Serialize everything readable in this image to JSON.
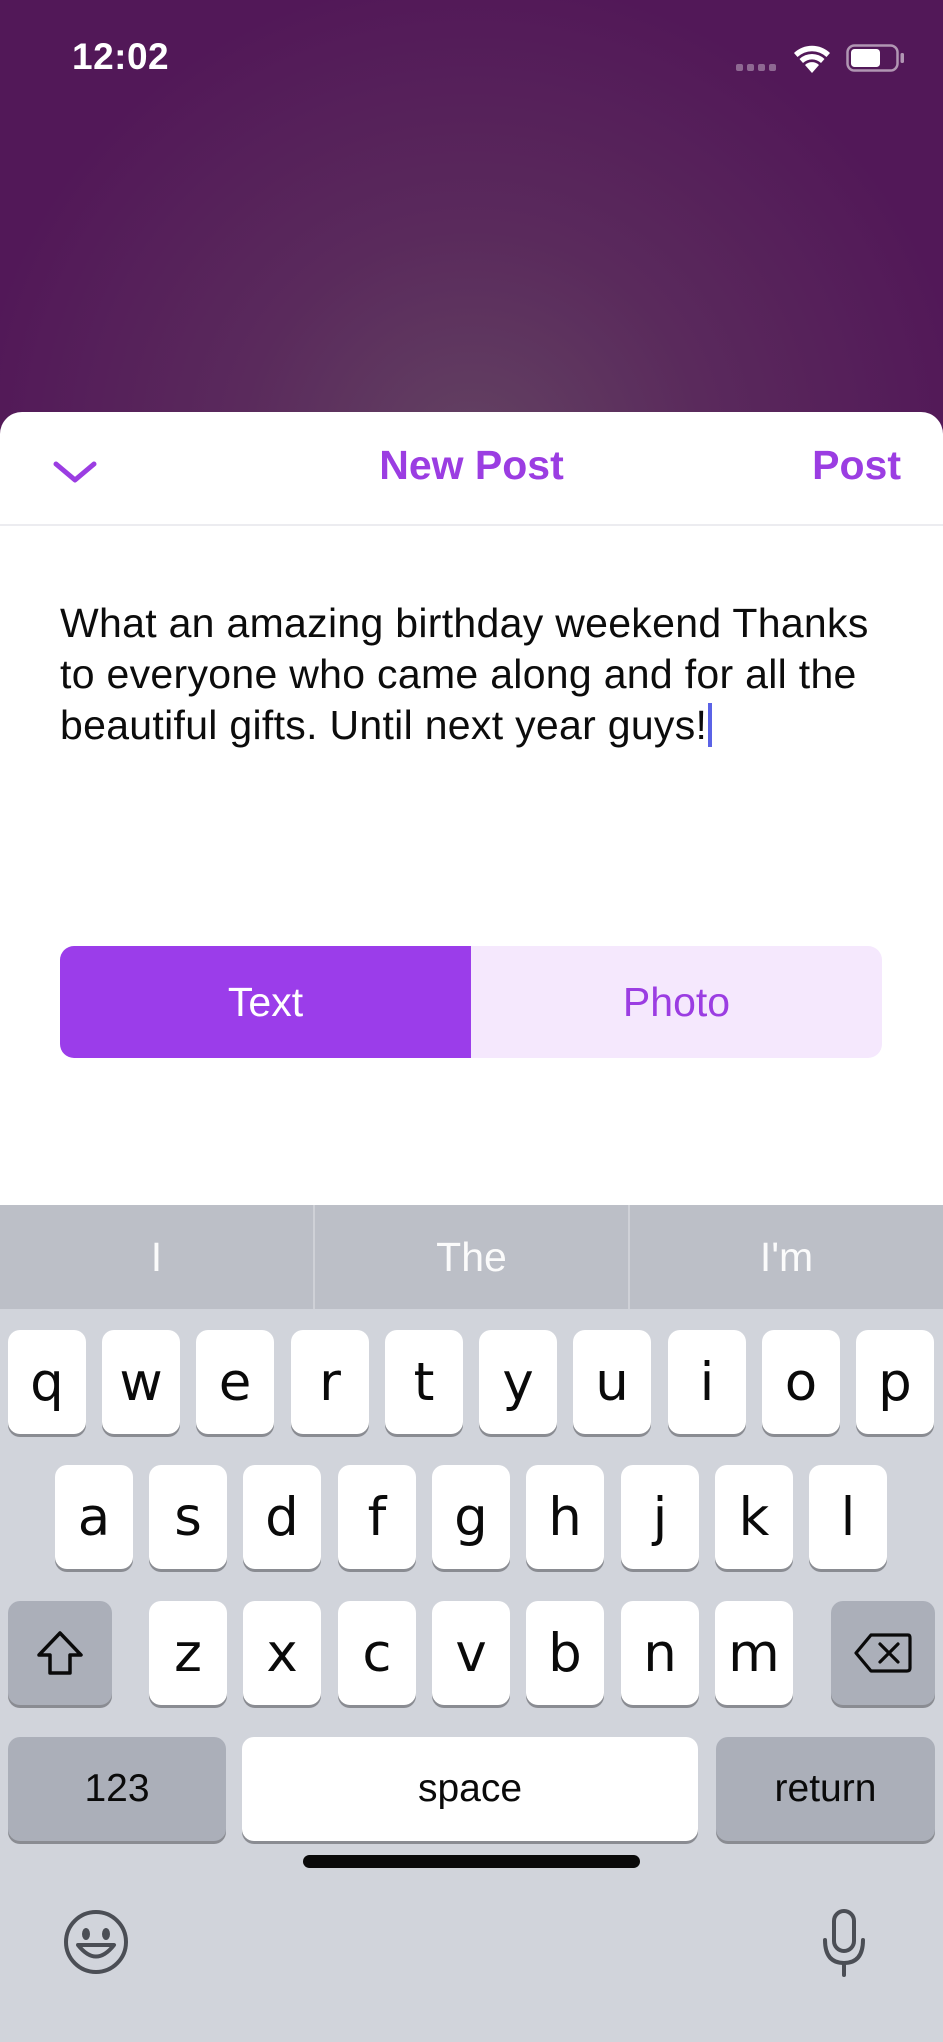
{
  "status": {
    "time": "12:02"
  },
  "header": {
    "title": "New Post",
    "post_label": "Post"
  },
  "composer": {
    "text": "What an amazing birthday weekend Thanks to everyone who came along and for all the beautiful gifts. Until next year guys!"
  },
  "mode_toggle": {
    "options": [
      "Text",
      "Photo"
    ],
    "selected": "Text"
  },
  "keyboard": {
    "predictions": [
      "I",
      "The",
      "I'm"
    ],
    "row1": [
      "q",
      "w",
      "e",
      "r",
      "t",
      "y",
      "u",
      "i",
      "o",
      "p"
    ],
    "row2": [
      "a",
      "s",
      "d",
      "f",
      "g",
      "h",
      "j",
      "k",
      "l"
    ],
    "row3": [
      "z",
      "x",
      "c",
      "v",
      "b",
      "n",
      "m"
    ],
    "numbers_label": "123",
    "space_label": "space",
    "return_label": "return",
    "icons": [
      "shift-icon",
      "delete-icon",
      "emoji-icon",
      "microphone-icon"
    ]
  },
  "colors": {
    "accent": "#9b3de2",
    "accent_light": "#f5e8fd",
    "backdrop": "#521858",
    "keyboard_bg": "#d1d4db"
  }
}
